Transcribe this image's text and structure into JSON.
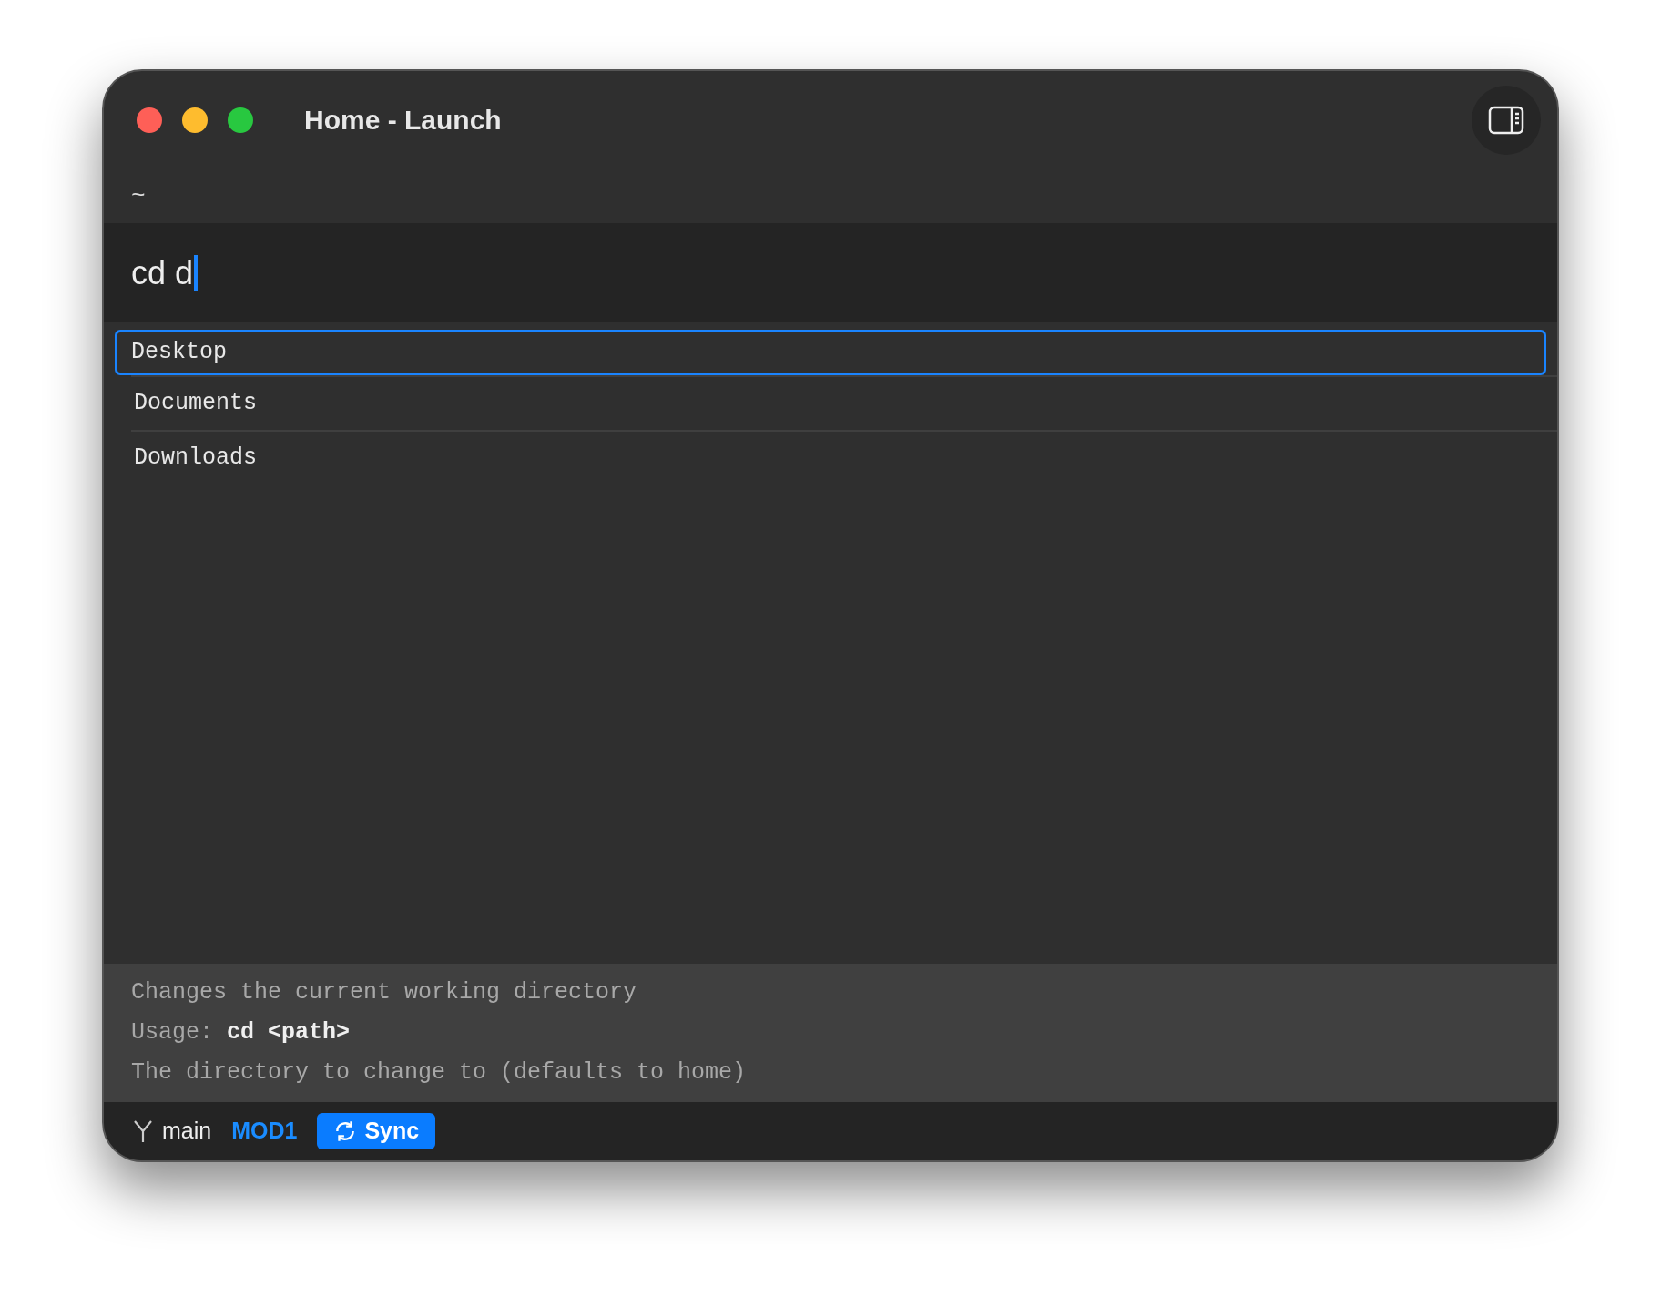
{
  "window": {
    "title": "Home - Launch"
  },
  "path": "~",
  "input": {
    "value": "cd d"
  },
  "suggestions": [
    {
      "label": "Desktop",
      "selected": true
    },
    {
      "label": "Documents",
      "selected": false
    },
    {
      "label": "Downloads",
      "selected": false
    }
  ],
  "help": [
    "Changes the current working directory",
    "Usage: **cd <path>**",
    "The directory to change to (defaults to home)"
  ],
  "status_bar": {
    "branch": "main",
    "mode": "MOD1",
    "sync_button": "Sync"
  }
}
